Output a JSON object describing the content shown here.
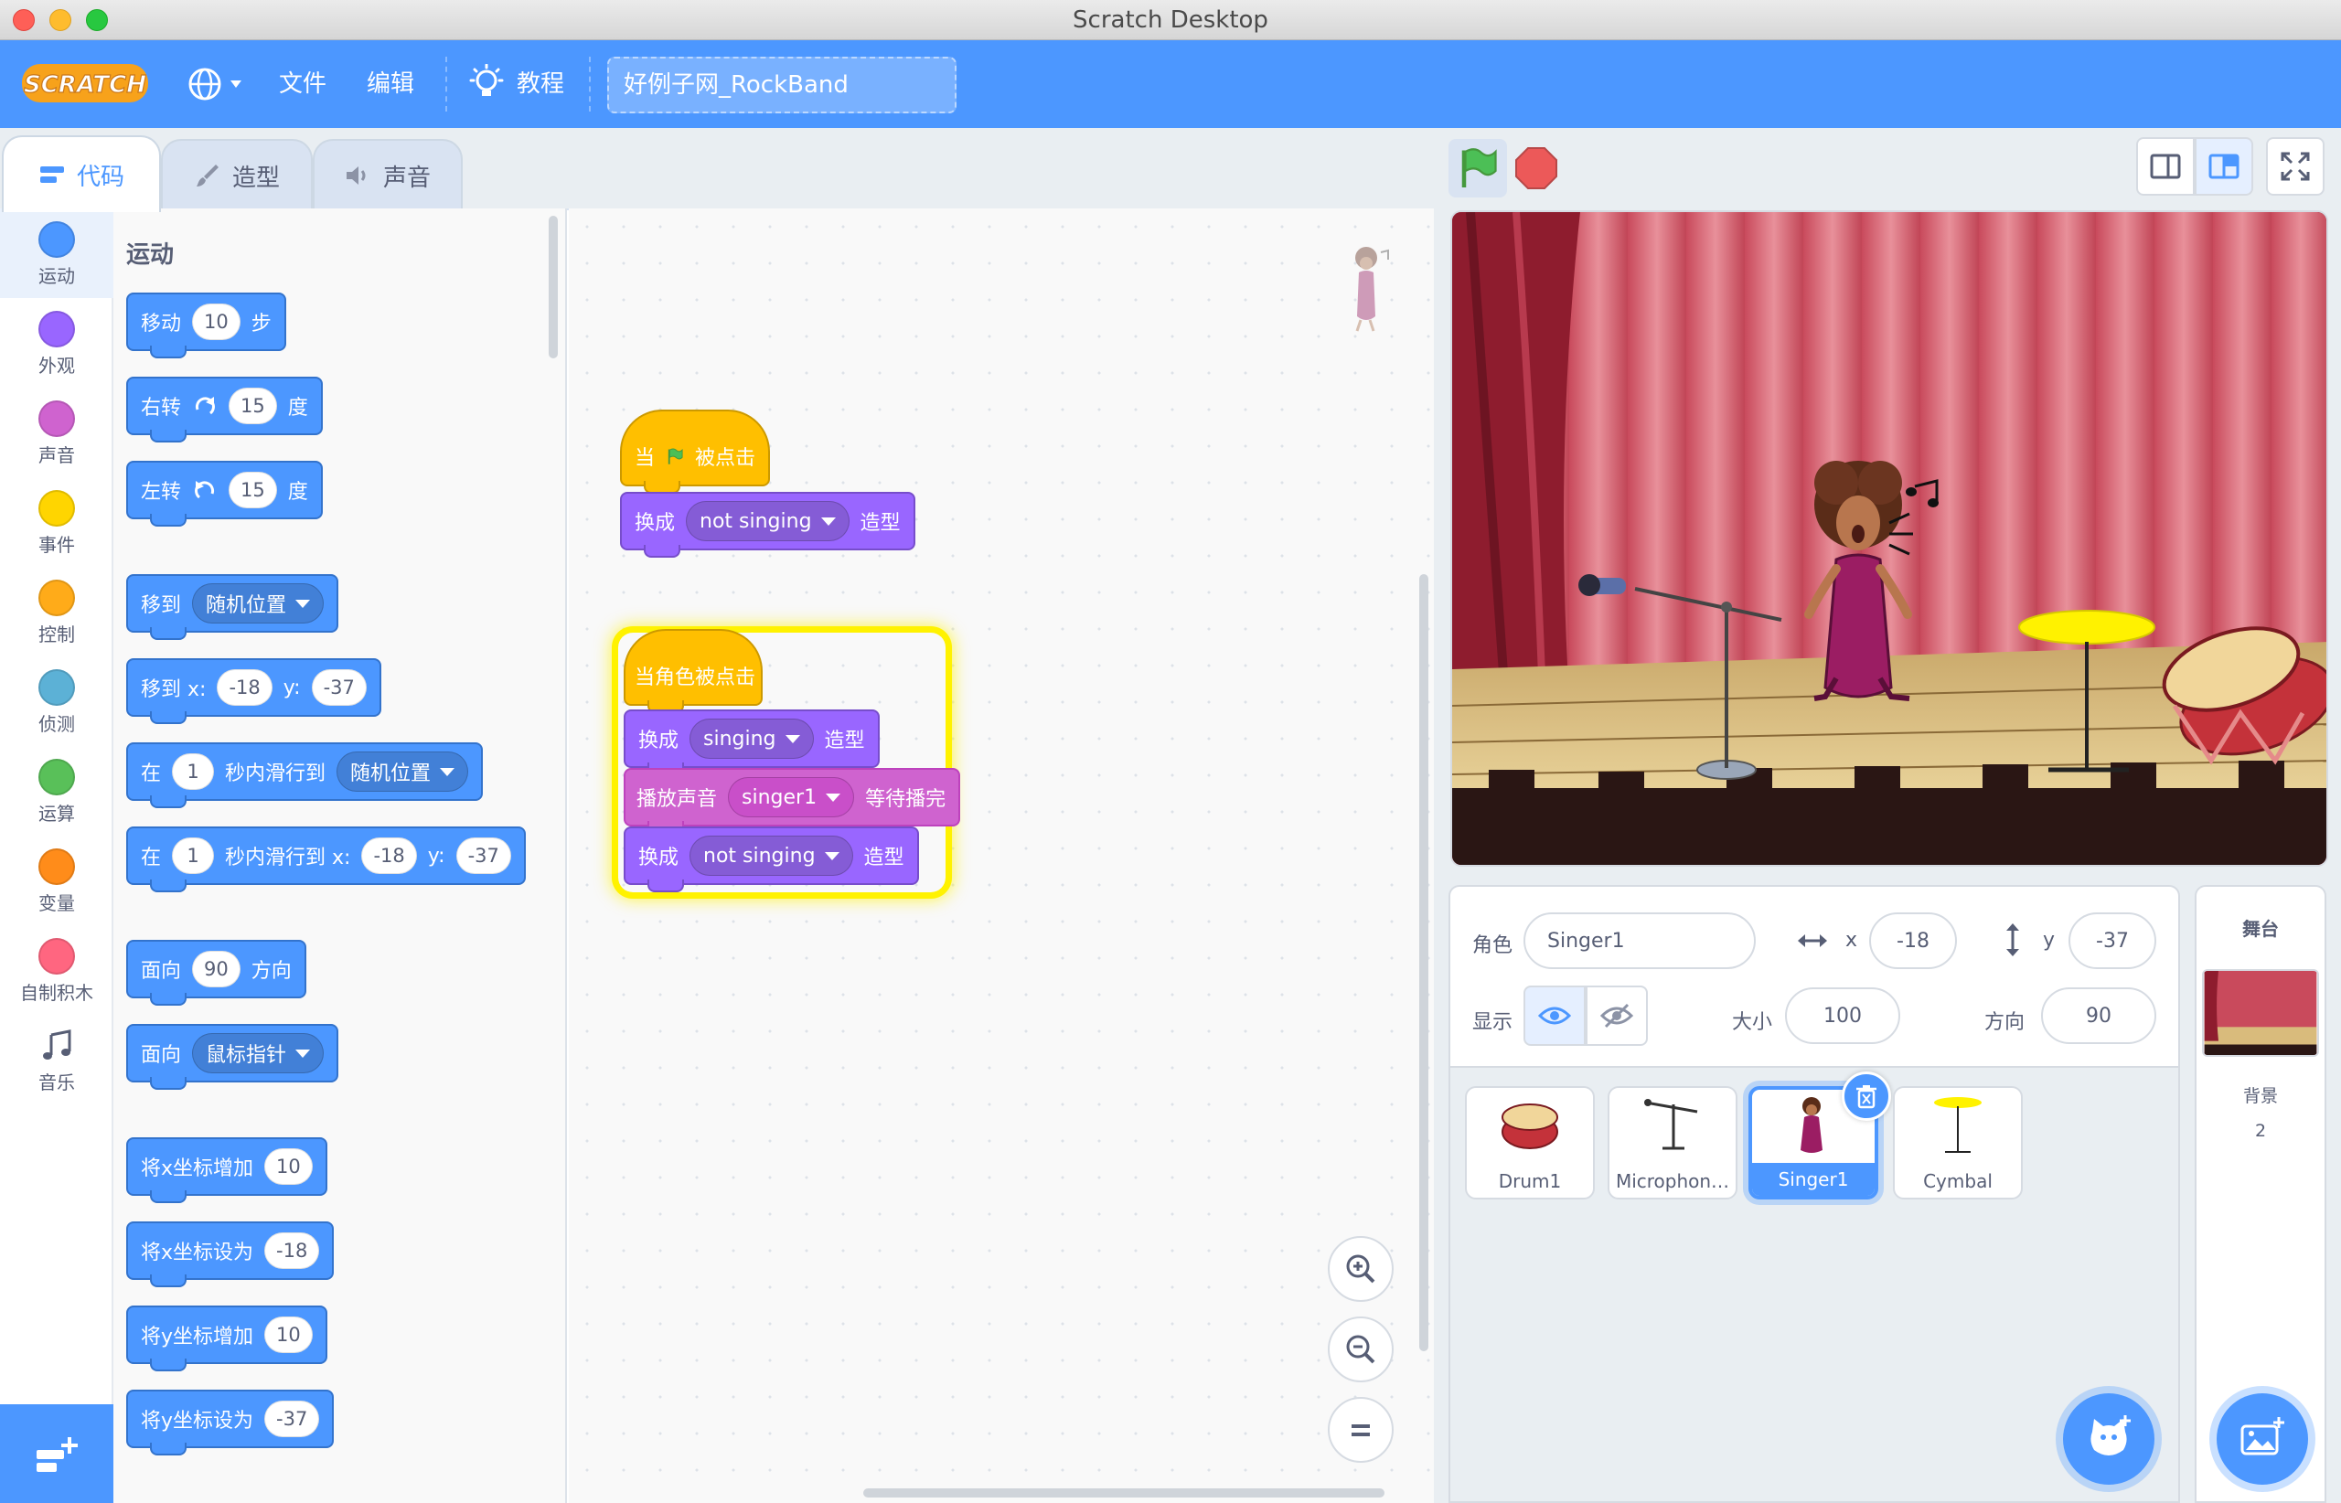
{
  "window": {
    "title": "Scratch Desktop"
  },
  "menubar": {
    "file": "文件",
    "edit": "编辑",
    "tutorials": "教程",
    "project_title": "好例子网_RockBand"
  },
  "tabs": [
    {
      "label": "代码",
      "icon": "code-icon"
    },
    {
      "label": "造型",
      "icon": "brush-icon"
    },
    {
      "label": "声音",
      "icon": "speaker-icon"
    }
  ],
  "categories": [
    {
      "label": "运动",
      "color": "#4c97ff"
    },
    {
      "label": "外观",
      "color": "#9966ff"
    },
    {
      "label": "声音",
      "color": "#cf63cf"
    },
    {
      "label": "事件",
      "color": "#ffd500"
    },
    {
      "label": "控制",
      "color": "#ffab19"
    },
    {
      "label": "侦测",
      "color": "#5cb1d6"
    },
    {
      "label": "运算",
      "color": "#59c059"
    },
    {
      "label": "变量",
      "color": "#ff8c1a"
    },
    {
      "label": "自制积木",
      "color": "#ff6680"
    },
    {
      "label": "音乐",
      "icon": "music-notes-icon"
    }
  ],
  "palette": {
    "heading": "运动",
    "blocks": {
      "move": {
        "a": "移动",
        "v": "10",
        "b": "步"
      },
      "turn_right": {
        "a": "右转",
        "v": "15",
        "b": "度"
      },
      "turn_left": {
        "a": "左转",
        "v": "15",
        "b": "度"
      },
      "goto": {
        "a": "移到",
        "d": "随机位置"
      },
      "goto_xy": {
        "a": "移到 x:",
        "x": "-18",
        "ylbl": "y:",
        "y": "-37"
      },
      "glide": {
        "a": "在",
        "v": "1",
        "b": "秒内滑行到",
        "d": "随机位置"
      },
      "glide_xy": {
        "a": "在",
        "v": "1",
        "b": "秒内滑行到 x:",
        "x": "-18",
        "ylbl": "y:",
        "y": "-37"
      },
      "point_dir": {
        "a": "面向",
        "v": "90",
        "b": "方向"
      },
      "point_towards": {
        "a": "面向",
        "d": "鼠标指针"
      },
      "change_x": {
        "a": "将x坐标增加",
        "v": "10"
      },
      "set_x": {
        "a": "将x坐标设为",
        "v": "-18"
      },
      "change_y": {
        "a": "将y坐标增加",
        "v": "10"
      },
      "set_y": {
        "a": "将y坐标设为",
        "v": "-37"
      }
    }
  },
  "scripts": {
    "s1": {
      "hat_a": "当",
      "hat_b": "被点击",
      "sw_a": "换成",
      "sw_d": "not singing",
      "sw_b": "造型"
    },
    "s2": {
      "hat": "当角色被点击",
      "sw1_a": "换成",
      "sw1_d": "singing",
      "sw1_b": "造型",
      "play_a": "播放声音",
      "play_d": "singer1",
      "play_b": "等待播完",
      "sw2_a": "换成",
      "sw2_d": "not singing",
      "sw2_b": "造型"
    }
  },
  "sprite_info": {
    "sprite_label": "角色",
    "sprite_name": "Singer1",
    "x_label": "x",
    "x": "-18",
    "y_label": "y",
    "y": "-37",
    "show_label": "显示",
    "size_label": "大小",
    "size": "100",
    "direction_label": "方向",
    "direction": "90"
  },
  "sprites": [
    {
      "name": "Drum1"
    },
    {
      "name": "Microphon…"
    },
    {
      "name": "Singer1",
      "selected": true
    },
    {
      "name": "Cymbal"
    }
  ],
  "stage_panel": {
    "title": "舞台",
    "backdrops_label": "背景",
    "backdrops_count": "2"
  }
}
